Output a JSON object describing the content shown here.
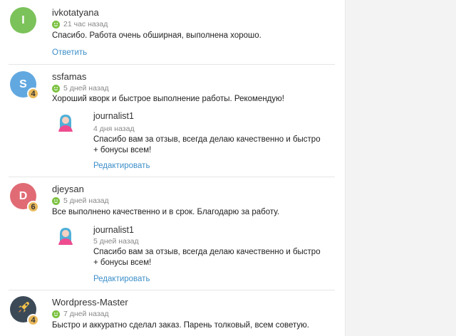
{
  "reviews": [
    {
      "initial": "I",
      "avatar_color": "#7cc25a",
      "username": "ivkotatyana",
      "time": "21 час назад",
      "text": "Спасибо. Работа очень обширная, выполнена хорошо.",
      "reply_link": "Ответить"
    },
    {
      "initial": "S",
      "avatar_color": "#62a8e0",
      "level": "4",
      "username": "ssfamas",
      "time": "5 дней назад",
      "text": "Хороший кворк и быстрое выполнение работы. Рекомендую!",
      "reply": {
        "name": "journalist1",
        "date": "4 дня назад",
        "text": "Спасибо вам за отзыв, всегда делаю качественно и быстро + бонусы всем!",
        "edit_link": "Редактировать"
      }
    },
    {
      "initial": "D",
      "avatar_color": "#e06b75",
      "level": "6",
      "username": "djeysan",
      "time": "5 дней назад",
      "text": "Все выполнено качественно и в срок. Благодарю за работу.",
      "reply": {
        "name": "journalist1",
        "date": "5 дней назад",
        "text": "Спасибо вам за отзыв, всегда делаю качественно и быстро + бонусы всем!",
        "edit_link": "Редактировать"
      }
    },
    {
      "avatar_icon": "rocket-icon",
      "avatar_color": "#3c4a57",
      "level": "4",
      "username": "Wordpress-Master",
      "time": "7 дней назад",
      "text": "Быстро и аккуратно сделал заказ. Парень толковый, всем советую."
    }
  ]
}
